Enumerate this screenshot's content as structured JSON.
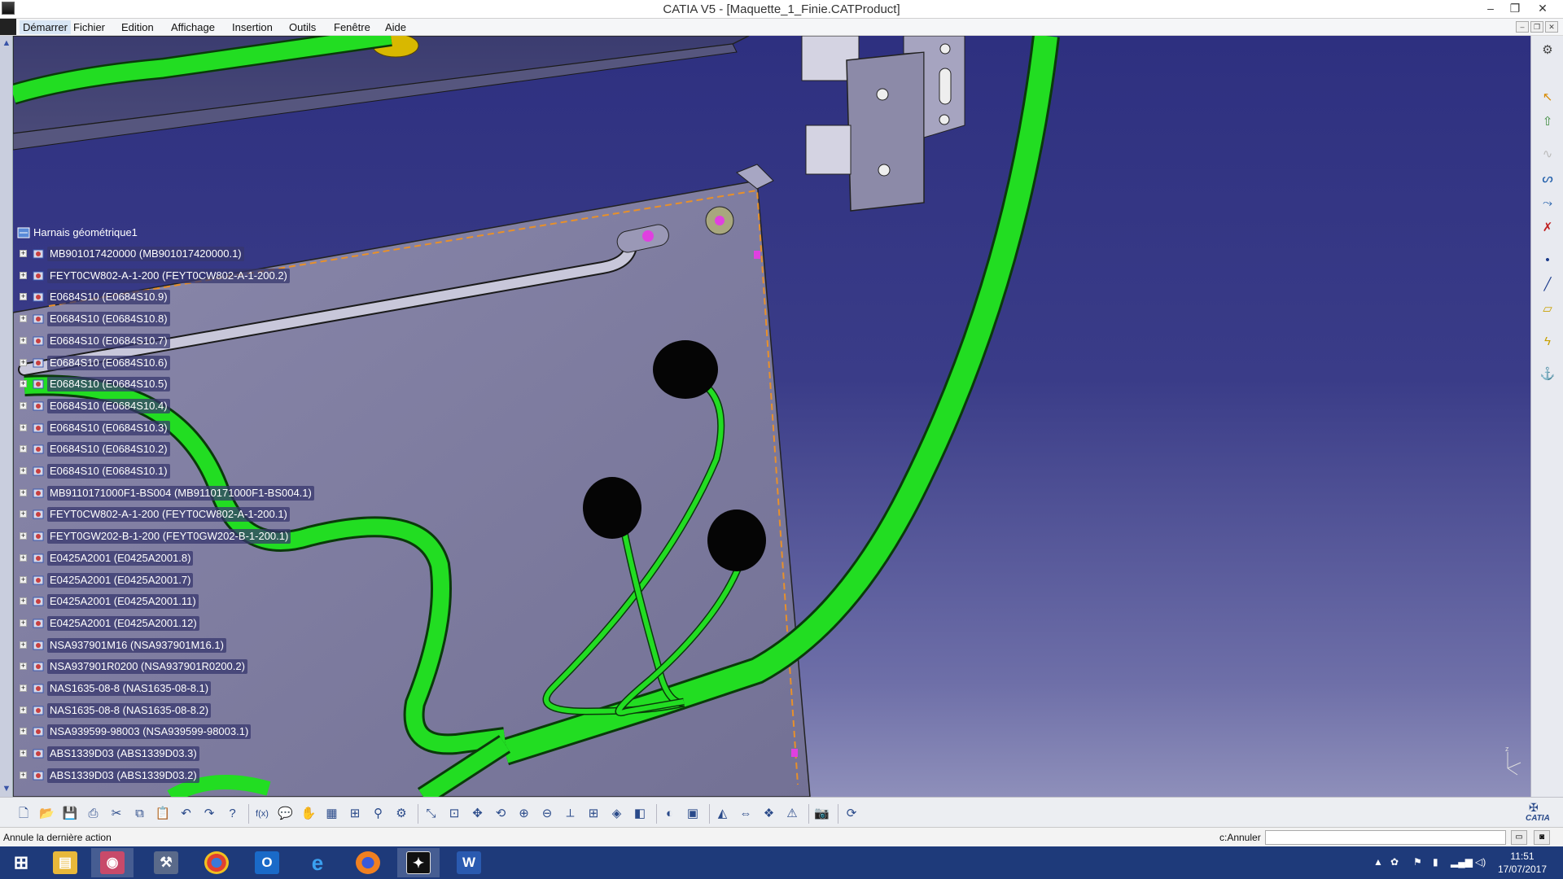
{
  "window": {
    "title": "CATIA V5 - [Maquette_1_Finie.CATProduct]",
    "controls": [
      "–",
      "❐",
      "✕"
    ]
  },
  "menu": {
    "items": [
      "Démarrer",
      "Fichier",
      "Edition",
      "Affichage",
      "Insertion",
      "Outils",
      "Fenêtre",
      "Aide"
    ],
    "active": "Démarrer"
  },
  "tree": {
    "root": "Harnais géométrique1",
    "nodes": [
      "MB901017420000 (MB901017420000.1)",
      "FEYT0CW802-A-1-200 (FEYT0CW802-A-1-200.2)",
      "E0684S10 (E0684S10.9)",
      "E0684S10 (E0684S10.8)",
      "E0684S10 (E0684S10.7)",
      "E0684S10 (E0684S10.6)",
      "E0684S10 (E0684S10.5)",
      "E0684S10 (E0684S10.4)",
      "E0684S10 (E0684S10.3)",
      "E0684S10 (E0684S10.2)",
      "E0684S10 (E0684S10.1)",
      "MB9110171000F1-BS004 (MB9110171000F1-BS004.1)",
      "FEYT0CW802-A-1-200 (FEYT0CW802-A-1-200.1)",
      "FEYT0GW202-B-1-200 (FEYT0GW202-B-1-200.1)",
      "E0425A2001 (E0425A2001.8)",
      "E0425A2001 (E0425A2001.7)",
      "E0425A2001 (E0425A2001.11)",
      "E0425A2001 (E0425A2001.12)",
      "NSA937901M16 (NSA937901M16.1)",
      "NSA937901R0200 (NSA937901R0200.2)",
      "NAS1635-08-8 (NAS1635-08-8.1)",
      "NAS1635-08-8 (NAS1635-08-8.2)",
      "NSA939599-98003 (NSA939599-98003.1)",
      "ABS1339D03 (ABS1339D03.3)",
      "ABS1339D03 (ABS1339D03.2)"
    ]
  },
  "status": {
    "message": "Annule la dernière action",
    "command_label": "c:Annuler",
    "command_value": ""
  },
  "clock": {
    "time": "11:51",
    "date": "17/07/2017"
  },
  "compass_label": "z",
  "brand": "CATIA",
  "colors": {
    "harness": "#22dd22",
    "viewport_top": "#2e3080",
    "plate": "#7d7b9e",
    "taskbar": "#1e3a7a"
  },
  "icons": {
    "bottom_toolbar": [
      "new-icon",
      "open-icon",
      "save-icon",
      "print-icon",
      "cut-icon",
      "copy-icon",
      "paste-icon",
      "undo-icon",
      "redo-icon",
      "whats-this-icon",
      "formula-icon",
      "comment-icon",
      "hand-icon",
      "table-icon",
      "catalog-icon",
      "measure-icon",
      "analysis-icon",
      "fit-all-icon",
      "zoom-area-icon",
      "pan-icon",
      "rotate-icon",
      "zoom-in-icon",
      "zoom-out-icon",
      "normal-view-icon",
      "multi-view-icon",
      "iso-view-icon",
      "shading-icon",
      "hide-show-icon",
      "swap-space-icon",
      "manipulate-icon",
      "snap-icon",
      "explode-icon",
      "clash-icon",
      "camera-icon",
      "refresh-icon"
    ],
    "right_toolbar": [
      "harness-icon",
      "select-icon",
      "export-icon",
      "bundle-icon",
      "segment-icon",
      "branch-icon",
      "protection-icon",
      "point-icon",
      "line-icon",
      "plane-icon",
      "flex-icon",
      "flatten-icon"
    ],
    "taskbar_apps": [
      "windows-start-icon",
      "file-explorer-icon",
      "catia-icon",
      "tools-icon",
      "chrome-icon",
      "outlook-icon",
      "internet-explorer-icon",
      "firefox-icon",
      "catia-v5-icon",
      "word-icon"
    ]
  }
}
